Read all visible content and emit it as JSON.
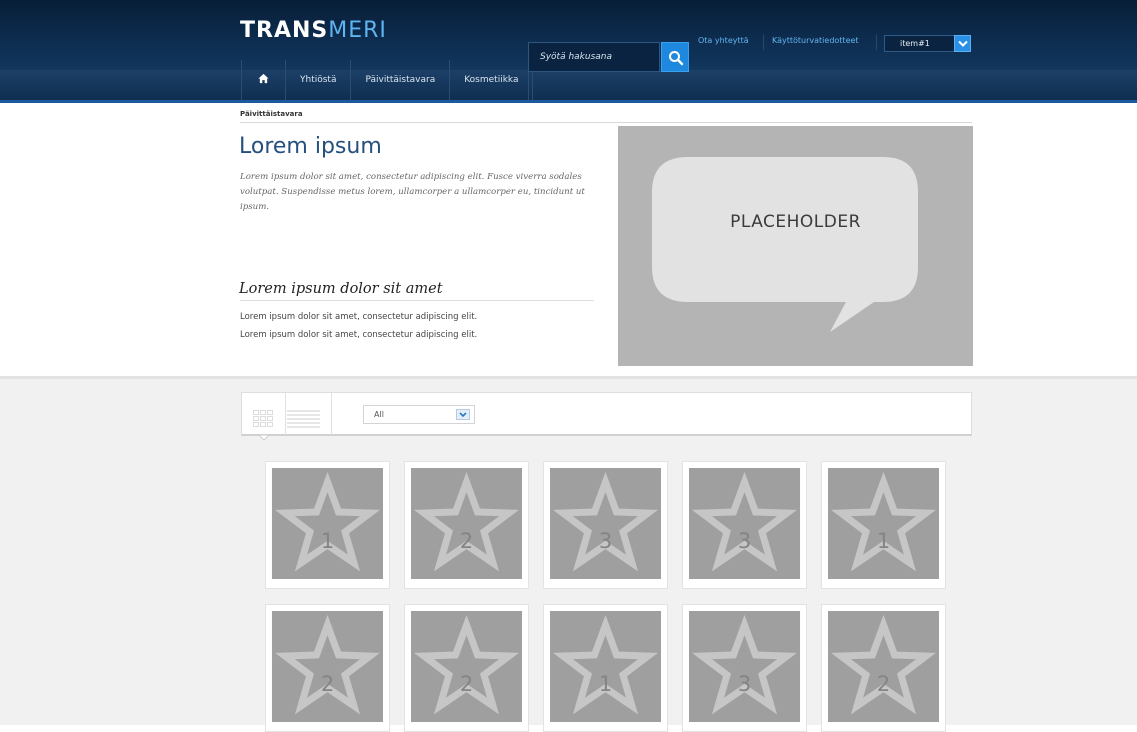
{
  "header": {
    "logo": {
      "part1": "TRANS",
      "part2": "MERI"
    },
    "nav": {
      "items": [
        "Yhtiöstä",
        "Päivittäistavara",
        "Kosmetiikka"
      ]
    },
    "search": {
      "placeholder": "Syötä hakusana"
    },
    "utility_links": [
      "Ota yhteyttä",
      "Käyttöturvatiedotteet"
    ],
    "item_select": {
      "value": "item#1"
    }
  },
  "hero": {
    "breadcrumb": "Päivittäistavara",
    "title": "Lorem ipsum",
    "intro": "Lorem ipsum dolor sit amet, consectetur adipiscing elit. Fusce viverra sodales volutpat. Suspendisse metus lorem, ullamcorper a ullamcorper eu, tincidunt ut ipsum.",
    "subtitle": "Lorem ipsum dolor sit amet",
    "lines": [
      "Lorem ipsum dolor sit amet, consectetur adipiscing elit.",
      "Lorem ipsum dolor sit amet, consectetur adipiscing elit."
    ],
    "placeholder_label": "PLACEHOLDER"
  },
  "gallery": {
    "filter": {
      "value": "All"
    },
    "products": [
      "1",
      "2",
      "3",
      "3",
      "1",
      "2",
      "2",
      "1",
      "3",
      "2"
    ]
  },
  "colors": {
    "header_bg": "#0e2e52",
    "accent_blue": "#1e88df",
    "logo_light": "#5fb4f0",
    "title_blue": "#24507e",
    "placeholder_gray": "#b4b4b4",
    "tile_gray": "#9f9f9f"
  },
  "icons": [
    "home-icon",
    "search-icon",
    "chevron-down-icon",
    "grid-view-icon",
    "list-view-icon",
    "speech-bubble-icon",
    "star-icon"
  ]
}
